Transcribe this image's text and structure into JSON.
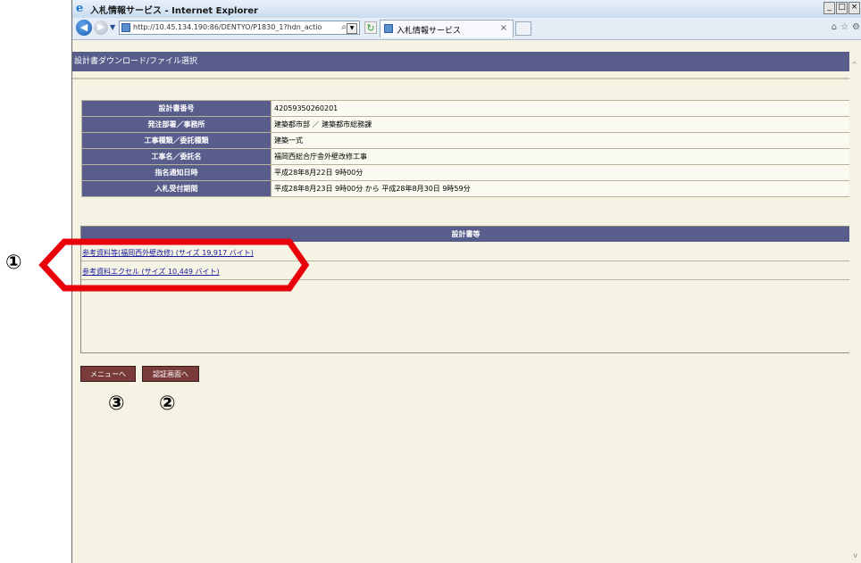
{
  "window": {
    "title": "入札情報サービス - Internet Explorer",
    "controls": [
      "_",
      "□",
      "×"
    ]
  },
  "browser": {
    "address": "http://10.45.134.190:86/DENTYO/P1830_1?hdn_actio",
    "tab_label": "入札情報サービス",
    "tab_close": "×"
  },
  "page": {
    "header": "設計書ダウンロード/ファイル選択",
    "info_rows": [
      {
        "label": "設計書番号",
        "value": "42059350260201"
      },
      {
        "label": "発注部署／事務所",
        "value": "建築都市部 ／ 建築都市総務課"
      },
      {
        "label": "工事種類／委託種類",
        "value": "建築一式"
      },
      {
        "label": "工事名／委託名",
        "value": "福岡西総合庁舎外壁改修工事"
      },
      {
        "label": "指名通知日時",
        "value": "平成28年8月22日 9時00分"
      },
      {
        "label": "入札受付期間",
        "value": "平成28年8月23日 9時00分 から 平成28年8月30日 9時59分"
      }
    ],
    "sekkei_header": "設計書等",
    "documents": [
      "参考資料等(福岡西外壁改修) (サイズ 19,917 バイト)",
      "参考資料エクセル (サイズ 10,449 バイト)"
    ],
    "buttons": {
      "menu": "メニューへ",
      "auth": "認証画面へ"
    }
  },
  "annotations": {
    "marker1": "①",
    "marker2": "②",
    "marker3": "③",
    "callout_color": "#e8000b"
  }
}
